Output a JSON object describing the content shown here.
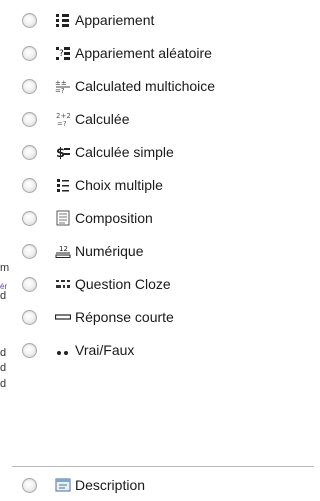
{
  "clipped_left_text": [
    "m",
    "ér",
    "d",
    "d",
    "d",
    "d"
  ],
  "question_types": [
    {
      "icon": "matching-icon",
      "label": "Appariement"
    },
    {
      "icon": "random-matching-icon",
      "label": "Appariement aléatoire"
    },
    {
      "icon": "calculated-multichoice-icon",
      "label": "Calculated multichoice"
    },
    {
      "icon": "calculated-icon",
      "label": "Calculée"
    },
    {
      "icon": "calculated-simple-icon",
      "label": "Calculée simple"
    },
    {
      "icon": "multiple-choice-icon",
      "label": "Choix multiple"
    },
    {
      "icon": "essay-icon",
      "label": "Composition"
    },
    {
      "icon": "numerical-icon",
      "label": "Numérique"
    },
    {
      "icon": "cloze-icon",
      "label": "Question Cloze"
    },
    {
      "icon": "short-answer-icon",
      "label": "Réponse courte"
    },
    {
      "icon": "true-false-icon",
      "label": "Vrai/Faux"
    }
  ],
  "other_types": [
    {
      "icon": "description-icon",
      "label": "Description"
    }
  ]
}
